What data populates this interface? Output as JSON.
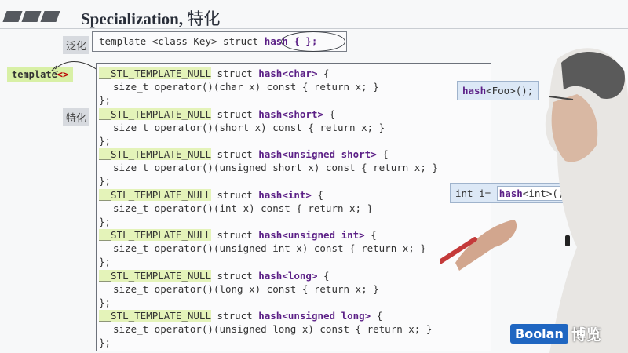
{
  "title": {
    "main": "Specialization,",
    "cn": "特化"
  },
  "labels": {
    "generic": "泛化",
    "specialized": "特化"
  },
  "primary_template": {
    "prefix": "template <class Key> struct ",
    "keyword": "hash { };"
  },
  "template_marker": {
    "text": "template",
    "brackets": "<>"
  },
  "specializations": [
    {
      "macro": "__STL_TEMPLATE_NULL",
      "struct": " struct ",
      "name": "hash<char>",
      "open": " {",
      "body": "size_t operator()(char x) const { return x; }",
      "close": "};"
    },
    {
      "macro": "__STL_TEMPLATE_NULL",
      "struct": " struct ",
      "name": "hash<short>",
      "open": " {",
      "body": "size_t operator()(short x) const { return x; }",
      "close": "};"
    },
    {
      "macro": "__STL_TEMPLATE_NULL",
      "struct": " struct ",
      "name": "hash<unsigned short>",
      "open": " {",
      "body": "size_t operator()(unsigned short x) const { return x; }",
      "close": "};"
    },
    {
      "macro": "__STL_TEMPLATE_NULL",
      "struct": " struct ",
      "name": "hash<int>",
      "open": " {",
      "body": "size_t operator()(int x) const { return x; }",
      "close": "};"
    },
    {
      "macro": "__STL_TEMPLATE_NULL",
      "struct": " struct ",
      "name": "hash<unsigned int>",
      "open": " {",
      "body": "size_t operator()(unsigned int x) const { return x; }",
      "close": "};"
    },
    {
      "macro": "__STL_TEMPLATE_NULL",
      "struct": " struct ",
      "name": "hash<long>",
      "open": " {",
      "body": "size_t operator()(long x) const { return x; }",
      "close": "};"
    },
    {
      "macro": "__STL_TEMPLATE_NULL",
      "struct": " struct ",
      "name": "hash<unsigned long>",
      "open": " {",
      "body": "size_t operator()(unsigned long x) const { return x; }",
      "close": "};"
    }
  ],
  "side_notes": {
    "foo": {
      "keyword": "hash",
      "rest": "<Foo>();"
    },
    "int_use": {
      "prefix": "int i= ",
      "keyword": "hash",
      "rest": "<int>()"
    }
  },
  "logo": {
    "brand": "Boolan",
    "cn": "博览"
  },
  "colors": {
    "keyword": "#5b1f86",
    "macro_highlight": "#e4f3b9",
    "note_box": "#dce8f6",
    "logo_blue": "#1f66c1"
  }
}
